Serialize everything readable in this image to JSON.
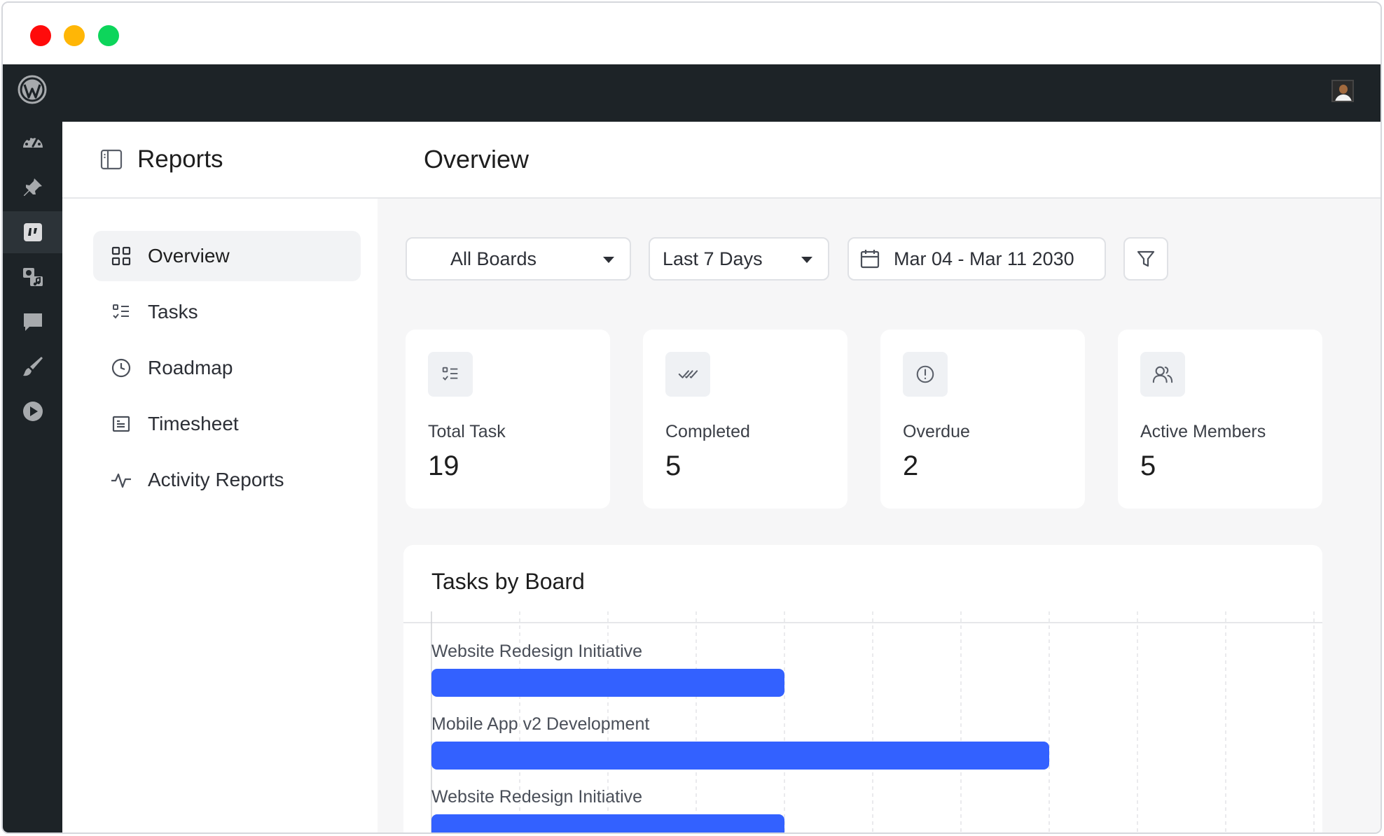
{
  "window": {
    "controls": [
      "close",
      "minimize",
      "maximize"
    ],
    "colors": {
      "close": "#ff0b0b",
      "minimize": "#ffb606",
      "maximize": "#0dd55b"
    }
  },
  "admin_bar": {
    "logo_icon": "wordpress-logo-icon",
    "avatar_icon": "user-avatar"
  },
  "wp_menu": {
    "items": [
      {
        "icon": "dashboard-icon"
      },
      {
        "icon": "pin-icon"
      },
      {
        "icon": "board-plugin-icon",
        "active": true
      },
      {
        "icon": "media-icon"
      },
      {
        "icon": "comments-icon"
      },
      {
        "icon": "appearance-brush-icon"
      },
      {
        "icon": "play-icon"
      }
    ]
  },
  "sidebar": {
    "title": "Reports",
    "items": [
      {
        "label": "Overview",
        "icon": "grid-icon",
        "active": true
      },
      {
        "label": "Tasks",
        "icon": "checklist-icon"
      },
      {
        "label": "Roadmap",
        "icon": "clock-icon"
      },
      {
        "label": "Timesheet",
        "icon": "timesheet-icon"
      },
      {
        "label": "Activity Reports",
        "icon": "activity-icon"
      }
    ]
  },
  "main": {
    "title": "Overview",
    "filters": {
      "board": "All Boards",
      "range": "Last 7 Days",
      "dates": "Mar 04 - Mar 11 2030"
    },
    "stats": [
      {
        "label": "Total Task",
        "value": "19",
        "icon": "checklist-icon"
      },
      {
        "label": "Completed",
        "value": "5",
        "icon": "double-check-icon"
      },
      {
        "label": "Overdue",
        "value": "2",
        "icon": "alert-circle-icon"
      },
      {
        "label": "Active Members",
        "value": "5",
        "icon": "users-icon"
      }
    ]
  },
  "chart_data": {
    "type": "bar",
    "orientation": "horizontal",
    "title": "Tasks by Board",
    "categories": [
      "Website Redesign Initiative",
      "Mobile App v2 Development",
      "Website Redesign Initiative"
    ],
    "values": [
      4,
      7,
      4
    ],
    "xlim": [
      0,
      10
    ],
    "grid": true,
    "bar_color": "#3361ff"
  }
}
